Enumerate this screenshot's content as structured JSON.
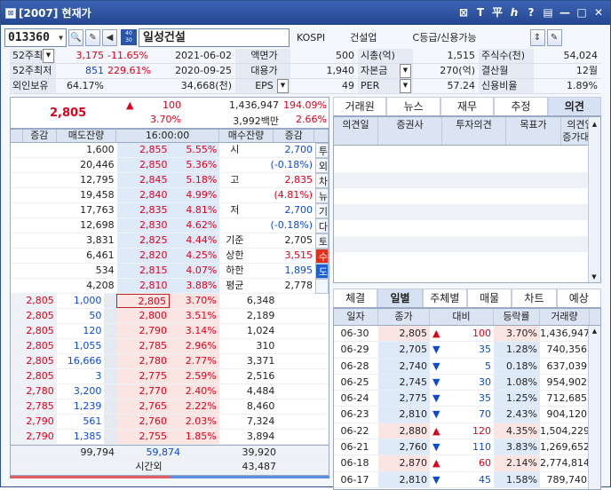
{
  "window": {
    "title": "[2007] 현재가",
    "controls": [
      "⊠",
      "T",
      "平",
      "ℎ",
      "?",
      "▤",
      "—",
      "□",
      "✕"
    ]
  },
  "toolbar": {
    "code": "013360",
    "name": "일성건설",
    "market": "KOSPI",
    "sector": "건설업",
    "grade": "C등급/신용가능",
    "badge": "40\n30"
  },
  "info": {
    "row1": {
      "l1": "52주최고",
      "v1": "3,175",
      "p1": "-11.65%",
      "d1": "2021-06-02",
      "l2": "액면가",
      "v2": "500",
      "l3": "시총(억)",
      "v3": "1,515",
      "l4": "주식수(천)",
      "v4": "54,024"
    },
    "row2": {
      "l1": "52주최저",
      "v1": "851",
      "p1": "229.61%",
      "d1": "2020-09-25",
      "l2": "대용가",
      "v2": "1,940",
      "l3": "자본금",
      "v3": "270(억)",
      "l4": "결산월",
      "v4": "12월"
    },
    "row3": {
      "l1": "외인보유",
      "v1": "64.17%",
      "v1b": "34,668(천)",
      "l2": "EPS",
      "v2": "49",
      "l3": "PER",
      "v3": "57.24",
      "l4": "신용비율",
      "v4": "1.89%"
    }
  },
  "summary": {
    "price": "2,805",
    "arrow": "▲",
    "change": "100",
    "rate": "3.70%",
    "volume": "1,436,947",
    "volrate": "194.09%",
    "amount": "3,992백만",
    "amtrate": "2.66%"
  },
  "orderbook": {
    "headers": [
      "증감",
      "매도잔량",
      "16:00:00",
      "매수잔량",
      "증감"
    ],
    "asks": [
      {
        "qty": "1,600",
        "price": "2,855",
        "rate": "5.55%"
      },
      {
        "qty": "20,446",
        "price": "2,850",
        "rate": "5.36%"
      },
      {
        "qty": "12,795",
        "price": "2,845",
        "rate": "5.18%"
      },
      {
        "qty": "19,458",
        "price": "2,840",
        "rate": "4.99%"
      },
      {
        "qty": "17,763",
        "price": "2,835",
        "rate": "4.81%"
      },
      {
        "qty": "12,698",
        "price": "2,830",
        "rate": "4.62%"
      },
      {
        "qty": "3,831",
        "price": "2,825",
        "rate": "4.44%"
      },
      {
        "qty": "6,461",
        "price": "2,820",
        "rate": "4.25%"
      },
      {
        "qty": "534",
        "price": "2,815",
        "rate": "4.07%"
      },
      {
        "qty": "4,208",
        "price": "2,810",
        "rate": "3.88%"
      }
    ],
    "stats": [
      {
        "label": "시",
        "value": "2,700",
        "cls": "blue"
      },
      {
        "label": "",
        "value": "(-0.18%)",
        "cls": "blue"
      },
      {
        "label": "고",
        "value": "2,835",
        "cls": "red"
      },
      {
        "label": "",
        "value": "(4.81%)",
        "cls": "red"
      },
      {
        "label": "저",
        "value": "2,700",
        "cls": "blue"
      },
      {
        "label": "",
        "value": "(-0.18%)",
        "cls": "blue"
      },
      {
        "label": "기준",
        "value": "2,705",
        "cls": ""
      },
      {
        "label": "상한",
        "value": "3,515",
        "cls": "red"
      },
      {
        "label": "하한",
        "value": "1,895",
        "cls": "blue"
      },
      {
        "label": "평균",
        "value": "2,778",
        "cls": ""
      }
    ],
    "vtabs": [
      "투",
      "외",
      "차",
      "뉴",
      "기",
      "다",
      "토",
      "수",
      "도"
    ],
    "ticks": [
      {
        "p": "2,805",
        "q": "1,000"
      },
      {
        "p": "2,805",
        "q": "50"
      },
      {
        "p": "2,805",
        "q": "120"
      },
      {
        "p": "2,805",
        "q": "1,055"
      },
      {
        "p": "2,805",
        "q": "16,666"
      },
      {
        "p": "2,805",
        "q": "3"
      },
      {
        "p": "2,780",
        "q": "3,200"
      },
      {
        "p": "2,785",
        "q": "1,239"
      },
      {
        "p": "2,790",
        "q": "561"
      },
      {
        "p": "2,790",
        "q": "1,385"
      }
    ],
    "bids": [
      {
        "price": "2,805",
        "rate": "3.70%",
        "qty": "6,348"
      },
      {
        "price": "2,800",
        "rate": "3.51%",
        "qty": "2,189"
      },
      {
        "price": "2,790",
        "rate": "3.14%",
        "qty": "1,024"
      },
      {
        "price": "2,785",
        "rate": "2.96%",
        "qty": "310"
      },
      {
        "price": "2,780",
        "rate": "2.77%",
        "qty": "3,371"
      },
      {
        "price": "2,775",
        "rate": "2.59%",
        "qty": "2,516"
      },
      {
        "price": "2,770",
        "rate": "2.40%",
        "qty": "4,484"
      },
      {
        "price": "2,765",
        "rate": "2.22%",
        "qty": "8,460"
      },
      {
        "price": "2,760",
        "rate": "2.03%",
        "qty": "7,324"
      },
      {
        "price": "2,755",
        "rate": "1.85%",
        "qty": "3,894"
      }
    ],
    "total_ask": "99,794",
    "total_mid": "59,874",
    "total_bid": "39,920",
    "after_label": "시간외",
    "after_qty": "43,487"
  },
  "opinion": {
    "tabs": [
      "거래원",
      "뉴스",
      "재무",
      "추정",
      "의견"
    ],
    "active": 4,
    "headers": [
      "의견일",
      "증권사",
      "투자의견",
      "목표가",
      "의견일\n증가대비"
    ]
  },
  "daily": {
    "tabs": [
      "체결",
      "일별",
      "주체별",
      "매물",
      "차트",
      "예상"
    ],
    "active": 1,
    "headers": [
      "일자",
      "종가",
      "대비",
      "등락률",
      "거래량"
    ],
    "rows": [
      {
        "date": "06-30",
        "close": "2,805",
        "dir": "up",
        "chg": "100",
        "rate": "3.70%",
        "vol": "1,436,947"
      },
      {
        "date": "06-29",
        "close": "2,705",
        "dir": "dn",
        "chg": "35",
        "rate": "1.28%",
        "vol": "740,356"
      },
      {
        "date": "06-28",
        "close": "2,740",
        "dir": "dn",
        "chg": "5",
        "rate": "0.18%",
        "vol": "637,039"
      },
      {
        "date": "06-25",
        "close": "2,745",
        "dir": "dn",
        "chg": "30",
        "rate": "1.08%",
        "vol": "954,902"
      },
      {
        "date": "06-24",
        "close": "2,775",
        "dir": "dn",
        "chg": "35",
        "rate": "1.25%",
        "vol": "712,685"
      },
      {
        "date": "06-23",
        "close": "2,810",
        "dir": "dn",
        "chg": "70",
        "rate": "2.43%",
        "vol": "904,120"
      },
      {
        "date": "06-22",
        "close": "2,880",
        "dir": "up",
        "chg": "120",
        "rate": "4.35%",
        "vol": "1,504,229"
      },
      {
        "date": "06-21",
        "close": "2,760",
        "dir": "dn",
        "chg": "110",
        "rate": "3.83%",
        "vol": "1,269,652"
      },
      {
        "date": "06-18",
        "close": "2,870",
        "dir": "up",
        "chg": "60",
        "rate": "2.14%",
        "vol": "2,774,814"
      },
      {
        "date": "06-17",
        "close": "2,810",
        "dir": "dn",
        "chg": "45",
        "rate": "1.58%",
        "vol": "789,740"
      }
    ]
  }
}
